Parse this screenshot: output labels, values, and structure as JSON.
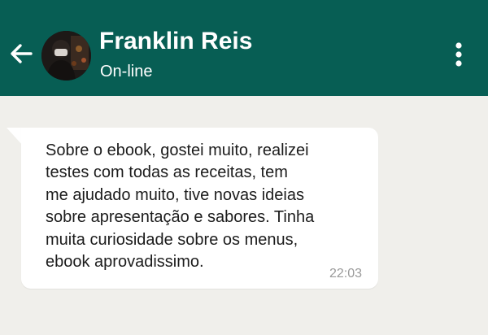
{
  "header": {
    "contact_name": "Franklin Reis",
    "status": "On-line",
    "background_color": "#075e54",
    "back_icon": "arrow-left-icon",
    "menu_icon": "more-vertical-icon"
  },
  "chat": {
    "background_color": "#f0efeb",
    "messages": [
      {
        "direction": "incoming",
        "lines": [
          "Sobre o ebook, gostei muito, realizei",
          "testes com todas as receitas, tem",
          "me ajudado muito, tive novas ideias",
          "sobre apresentação e sabores. Tinha",
          "muita curiosidade sobre os menus,",
          "ebook aprovadissimo."
        ],
        "time": "22:03"
      }
    ]
  }
}
